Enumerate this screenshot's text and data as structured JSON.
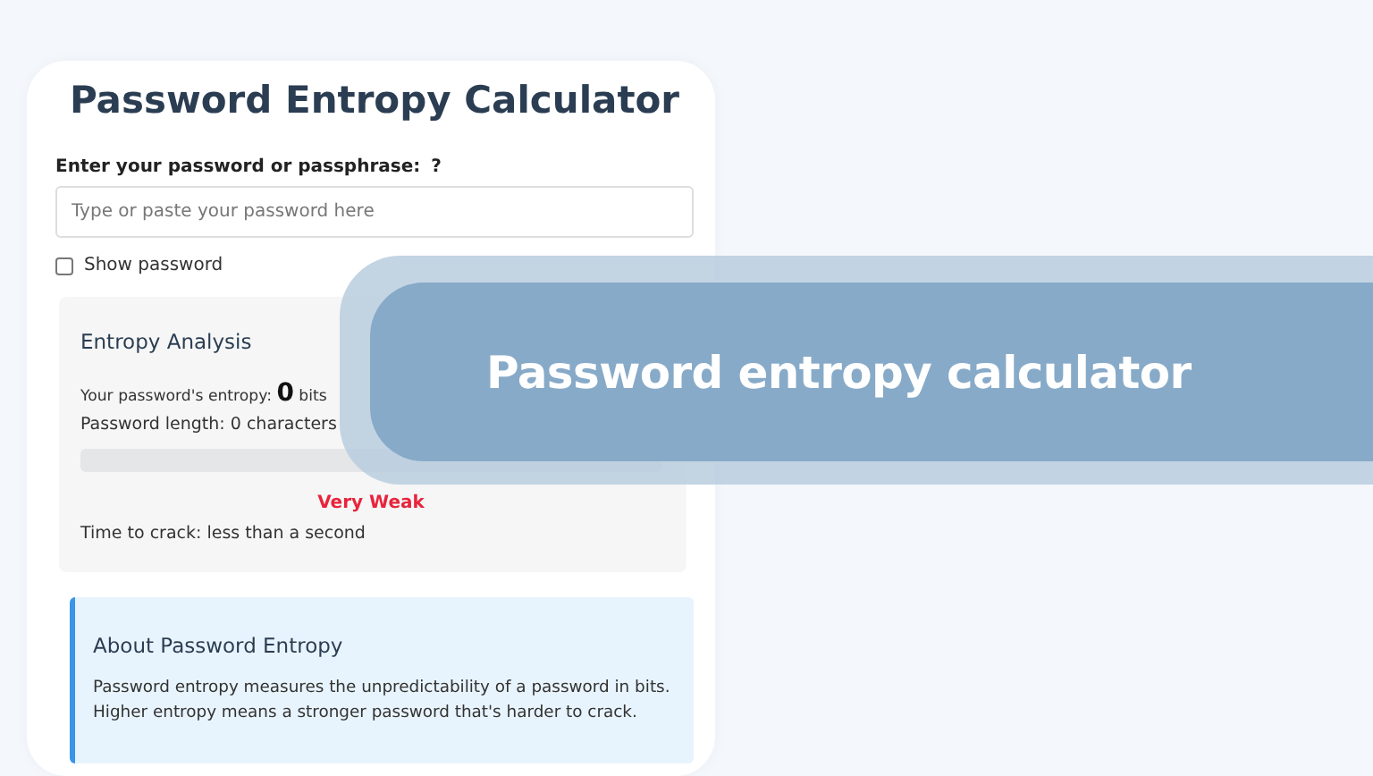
{
  "title": "Password Entropy Calculator",
  "password_field": {
    "label": "Enter your password or passphrase:",
    "help": "?",
    "placeholder": "Type or paste your password here"
  },
  "show_password": {
    "label": "Show password",
    "checked": false
  },
  "analysis": {
    "heading": "Entropy Analysis",
    "entropy_label": "Your password's entropy:",
    "entropy_value": "0",
    "entropy_unit": "bits",
    "length": "Password length: 0 characters",
    "strength_meter": {
      "level": 0
    },
    "strength": {
      "label": "Very Weak",
      "color": "#e8243c"
    },
    "crack_time": "Time to crack: less than a second"
  },
  "about": {
    "heading": "About Password Entropy",
    "text": "Password entropy measures the unpredictability of a password in bits. Higher entropy means a stronger password that's harder to crack."
  },
  "banner": {
    "text": "Password entropy calculator"
  }
}
